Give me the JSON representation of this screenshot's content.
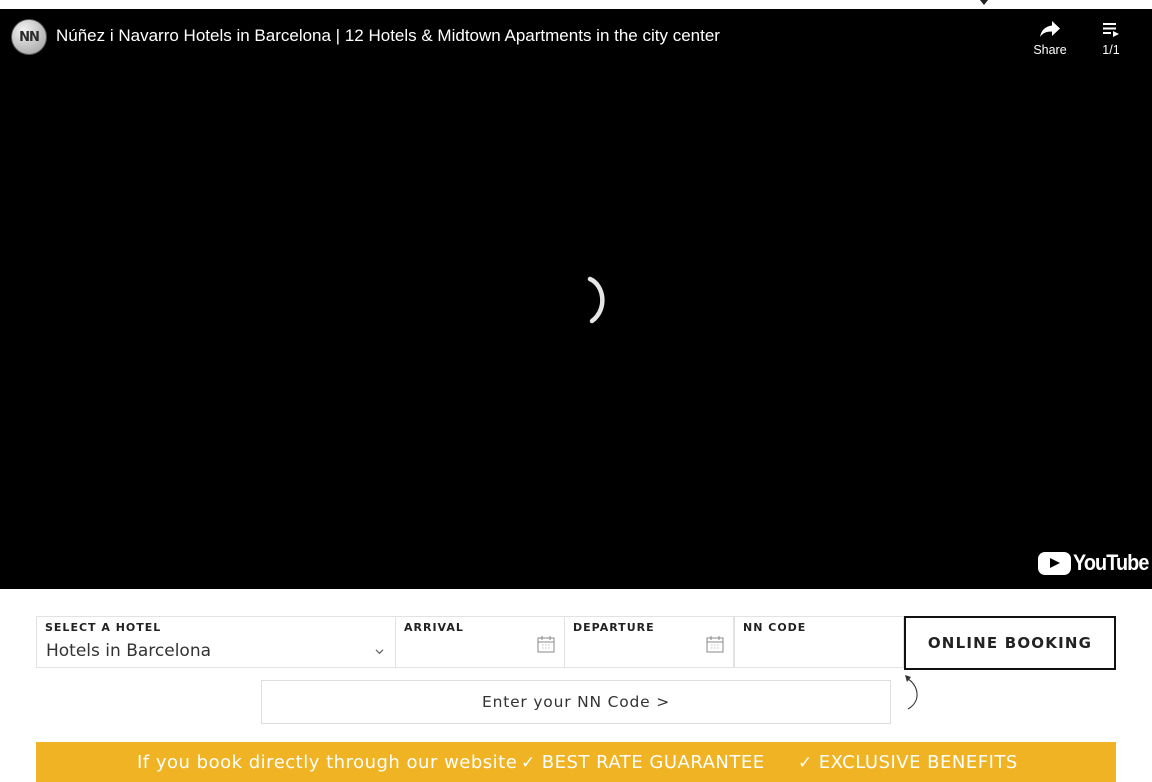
{
  "video": {
    "channel_logo_text": "NN",
    "title": "Núñez i Navarro Hotels in Barcelona | 12 Hotels & Midtown Apartments in the city center",
    "share_label": "Share",
    "playlist_count": "1/1",
    "brand": "YouTube"
  },
  "booking": {
    "hotel_label": "SELECT A HOTEL",
    "hotel_value": "Hotels in Barcelona",
    "arrival_label": "ARRIVAL",
    "departure_label": "DEPARTURE",
    "code_label": "NN CODE",
    "book_button": "ONLINE BOOKING",
    "code_button": "Enter your NN Code >"
  },
  "banner": {
    "text": "If you book directly through our website",
    "benefit_1": "BEST RATE GUARANTEE",
    "benefit_2": "EXCLUSIVE BENEFITS",
    "color": "#f0b323"
  }
}
